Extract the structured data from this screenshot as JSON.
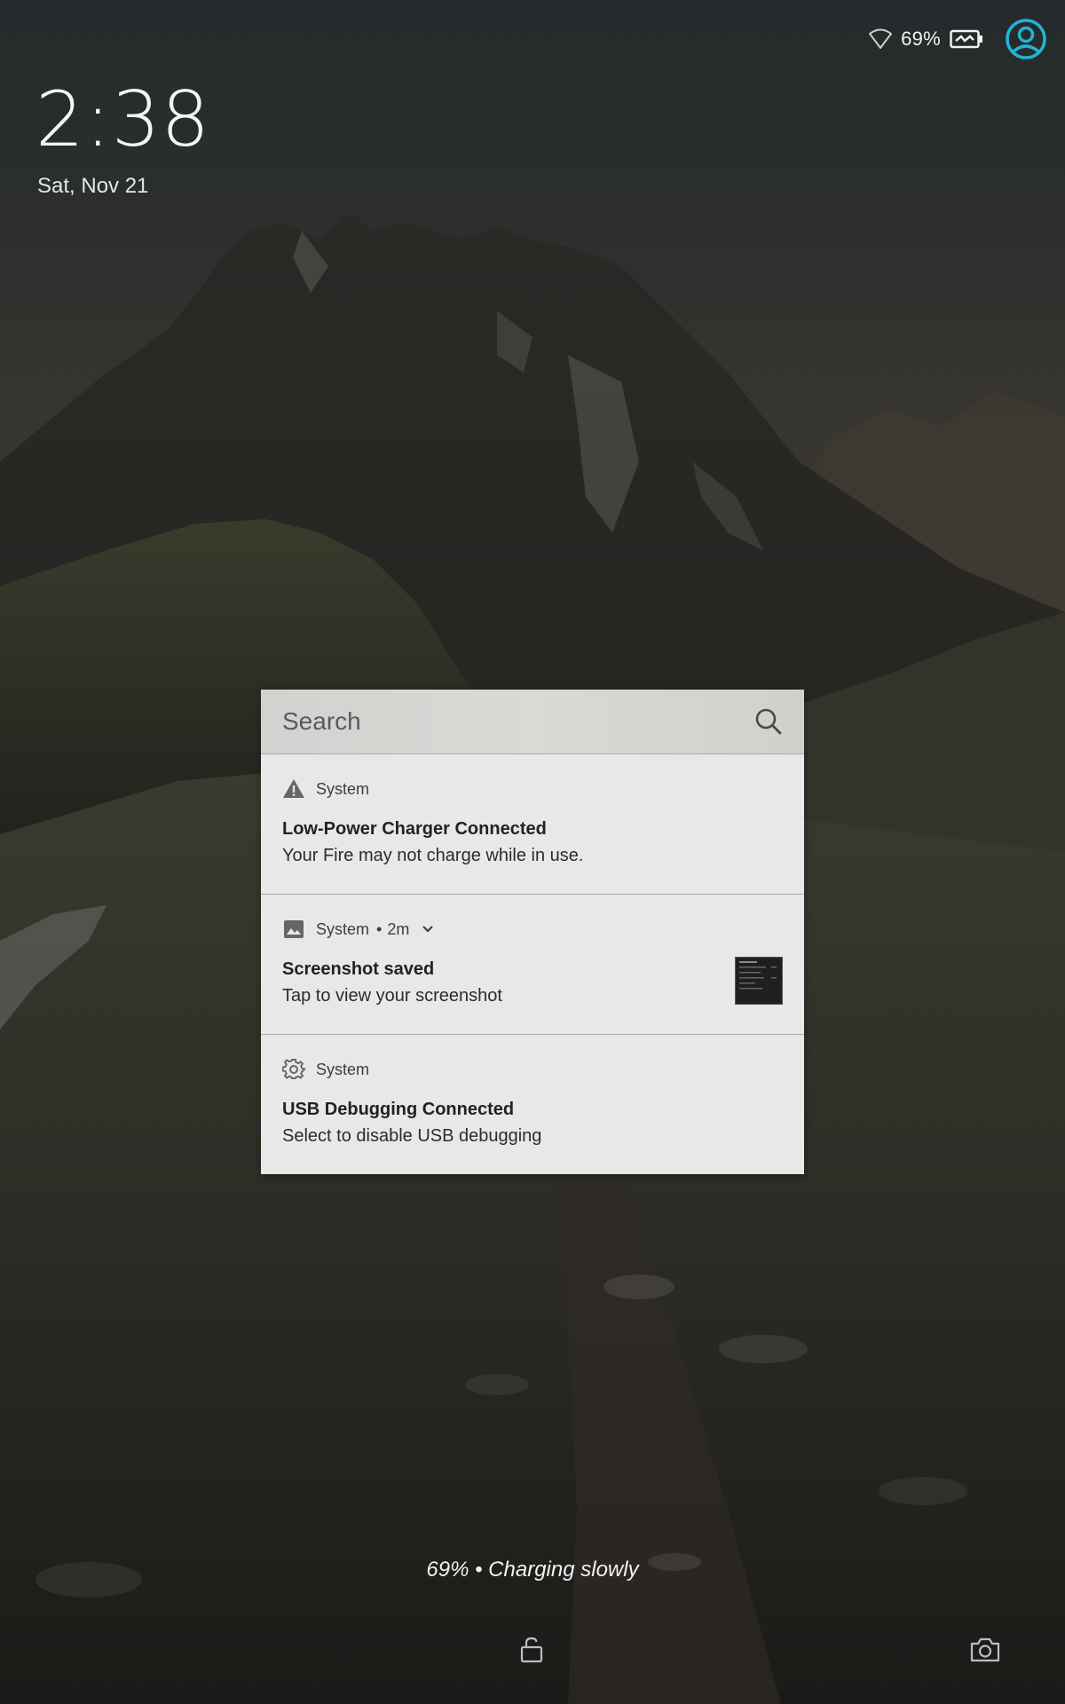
{
  "status_bar": {
    "battery_percent": "69%",
    "wifi_icon": "wifi-icon",
    "battery_icon": "battery-charging-icon",
    "avatar_icon": "user-avatar-icon",
    "accent_color": "#1fb5d6"
  },
  "lock": {
    "time": "2:38",
    "date": "Sat, Nov 21"
  },
  "search": {
    "placeholder": "Search",
    "icon": "search-icon"
  },
  "notifications": [
    {
      "icon": "warning-icon",
      "app": "System",
      "title": "Low-Power Charger Connected",
      "text": "Your Fire may not charge while in use."
    },
    {
      "icon": "image-icon",
      "app": "System",
      "separator": "•",
      "time": "2m",
      "title": "Screenshot saved",
      "text": "Tap to view your screenshot"
    },
    {
      "icon": "gear-icon",
      "app": "System",
      "title": "USB Debugging Connected",
      "text": "Select to disable USB debugging"
    }
  ],
  "bottom": {
    "charging_status": "69% • Charging slowly",
    "unlock_icon": "unlock-icon",
    "camera_icon": "camera-icon"
  }
}
